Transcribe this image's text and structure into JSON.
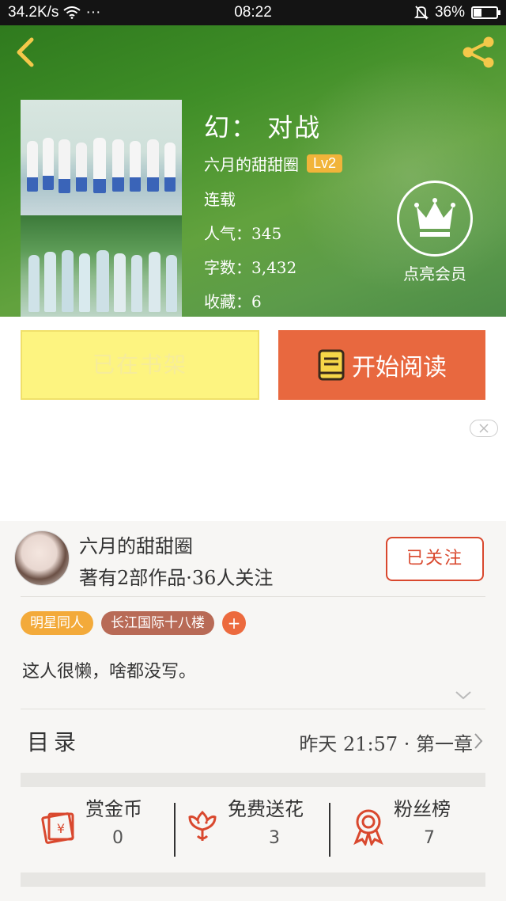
{
  "status_bar": {
    "speed": "34.2K/s",
    "more": "···",
    "time": "08:22",
    "battery": "36%",
    "battery_level": 0.36
  },
  "book": {
    "title": "幻： 对战",
    "author": "六月的甜甜圈",
    "level": "Lv2",
    "status": "连载",
    "popularity": "人气：345",
    "word_count": "字数：3,432",
    "favorites": "收藏：6",
    "vip_label": "点亮会员"
  },
  "actions": {
    "in_shelf": "已在书架",
    "start_reading": "开始阅读"
  },
  "author_card": {
    "name": "六月的甜甜圈",
    "stats": "著有2部作品·36人关注",
    "follow_label": "已关注",
    "tags": [
      {
        "label": "明星同人",
        "color": "#f3aa3a"
      },
      {
        "label": "长江国际十八楼",
        "color": "#b86a56"
      }
    ],
    "add_tag": "+",
    "intro": "这人很懒，啥都没写。"
  },
  "toc": {
    "label": "目录",
    "latest": "昨天 21:57 · 第一章"
  },
  "rewards": [
    {
      "label": "赏金币",
      "value": "0",
      "icon": "red-envelope-icon"
    },
    {
      "label": "免费送花",
      "value": "3",
      "icon": "flower-icon"
    },
    {
      "label": "粉丝榜",
      "value": "7",
      "icon": "medal-icon"
    }
  ],
  "colors": {
    "accent_orange": "#e8683f",
    "follow_red": "#d9482e",
    "shelf_yellow": "#fdf480",
    "lv_badge": "#f1b43a"
  }
}
